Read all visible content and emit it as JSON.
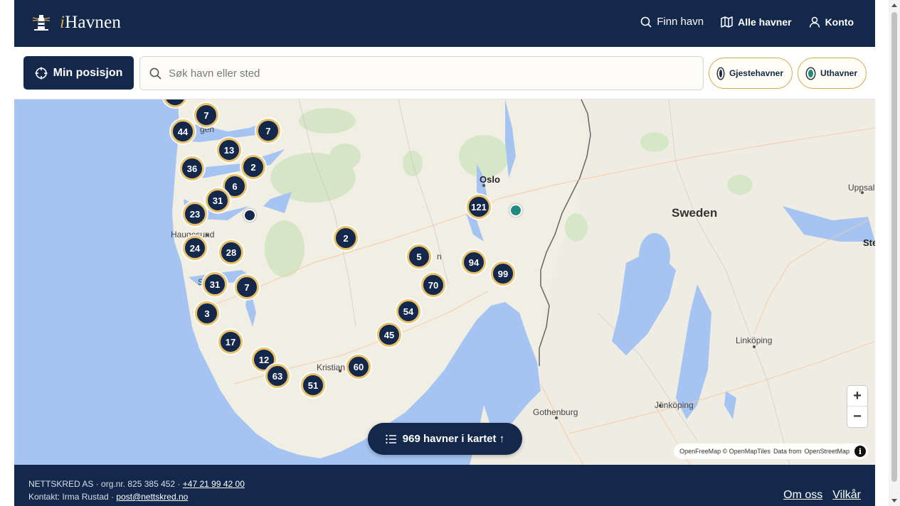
{
  "header": {
    "logo_letter": "i",
    "logo_rest": "Havnen",
    "nav": [
      {
        "label": "Finn havn",
        "icon": "search-icon"
      },
      {
        "label": "Alle havner",
        "icon": "map-icon"
      },
      {
        "label": "Konto",
        "icon": "user-icon"
      }
    ]
  },
  "toolbar": {
    "position_button": "Min posisjon",
    "search_placeholder": "Søk havn eller sted",
    "filters": [
      {
        "label": "Gjestehavner",
        "color": "#13284a"
      },
      {
        "label": "Uthavner",
        "color": "#1f8a7e"
      }
    ]
  },
  "map": {
    "clusters": [
      "7",
      "44",
      "7",
      "13",
      "36",
      "2",
      "6",
      "31",
      "23",
      "24",
      "28",
      "2",
      "5",
      "121",
      "94",
      "99",
      "70",
      "31",
      "7",
      "3",
      "54",
      "45",
      "17",
      "12",
      "63",
      "60",
      "51"
    ],
    "labels": {
      "oslo": "Oslo",
      "sweden": "Sweden",
      "haugesund": "Haugesund",
      "kristiansand": "Kristian",
      "uppsala": "Uppsal",
      "stockholm": "Ste",
      "linkoping": "Linköping",
      "jonkoping": "Jönköping",
      "gothenburg": "Gothenburg",
      "bergen_fragment": "gen",
      "stavanger_fragment": "S",
      "arendal_fragment": "n"
    },
    "zoom_in": "+",
    "zoom_out": "−",
    "attribution_a": "OpenFreeMap © OpenMapTiles",
    "attribution_b": "Data from",
    "attribution_c": "OpenStreetMap",
    "list_button": "969 havner i kartet ↑"
  },
  "footer": {
    "company": "NETTSKRED AS · org.nr. 825 385 452 ·",
    "phone": "+47 21 99 42 00",
    "contact_prefix": "Kontakt: Irma Rustad ·",
    "email": "post@nettskred.no",
    "links": [
      "Om oss",
      "Vilkår"
    ]
  }
}
